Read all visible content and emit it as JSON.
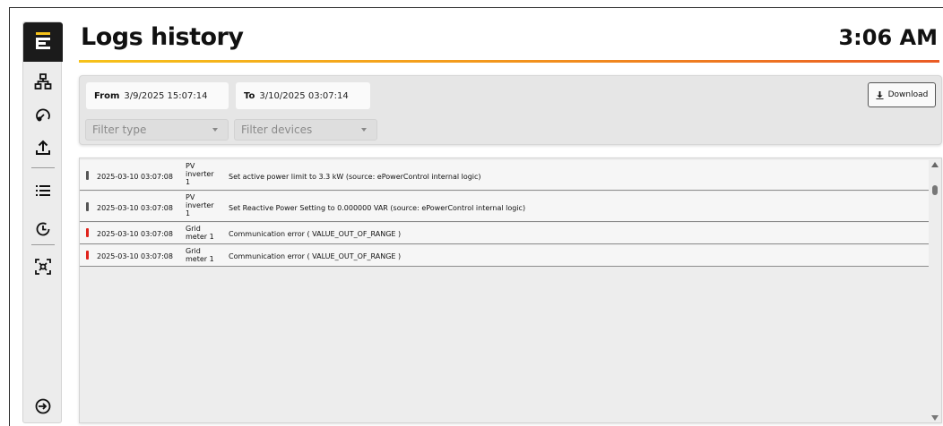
{
  "app": {
    "logo_icon": "e-logo-icon",
    "accent_colors": [
      "#f6c21a",
      "#f39a1c",
      "#ea5b25"
    ]
  },
  "sidebar": {
    "items": [
      {
        "icon": "sitemap-icon"
      },
      {
        "icon": "gauge-icon"
      },
      {
        "icon": "upload-icon"
      },
      {
        "icon": "list-icon"
      },
      {
        "icon": "history-clock-icon"
      },
      {
        "icon": "scan-icon"
      },
      {
        "icon": "logout-icon"
      }
    ]
  },
  "header": {
    "title": "Logs history",
    "clock": "3:06 AM"
  },
  "filters": {
    "from_label": "From",
    "from_value": "3/9/2025 15:07:14",
    "to_label": "To",
    "to_value": "3/10/2025 03:07:14",
    "download_label": "Download",
    "filter_type_placeholder": "Filter type",
    "filter_devices_placeholder": "Filter devices"
  },
  "logs": [
    {
      "timestamp": "2025-03-10 03:07:08",
      "device": "PV inverter 1",
      "message": "Set active power limit to 3.3 kW (source: ePowerControl internal logic)",
      "level_color": "#555555"
    },
    {
      "timestamp": "2025-03-10 03:07:08",
      "device": "PV inverter 1",
      "message": "Set Reactive Power Setting to 0.000000 VAR (source: ePowerControl internal logic)",
      "level_color": "#555555"
    },
    {
      "timestamp": "2025-03-10 03:07:08",
      "device": "Grid meter 1",
      "message": "Communication error ( VALUE_OUT_OF_RANGE )",
      "level_color": "#e0231c"
    },
    {
      "timestamp": "2025-03-10 03:07:08",
      "device": "Grid meter 1",
      "message": "Communication error ( VALUE_OUT_OF_RANGE )",
      "level_color": "#e0231c"
    }
  ]
}
